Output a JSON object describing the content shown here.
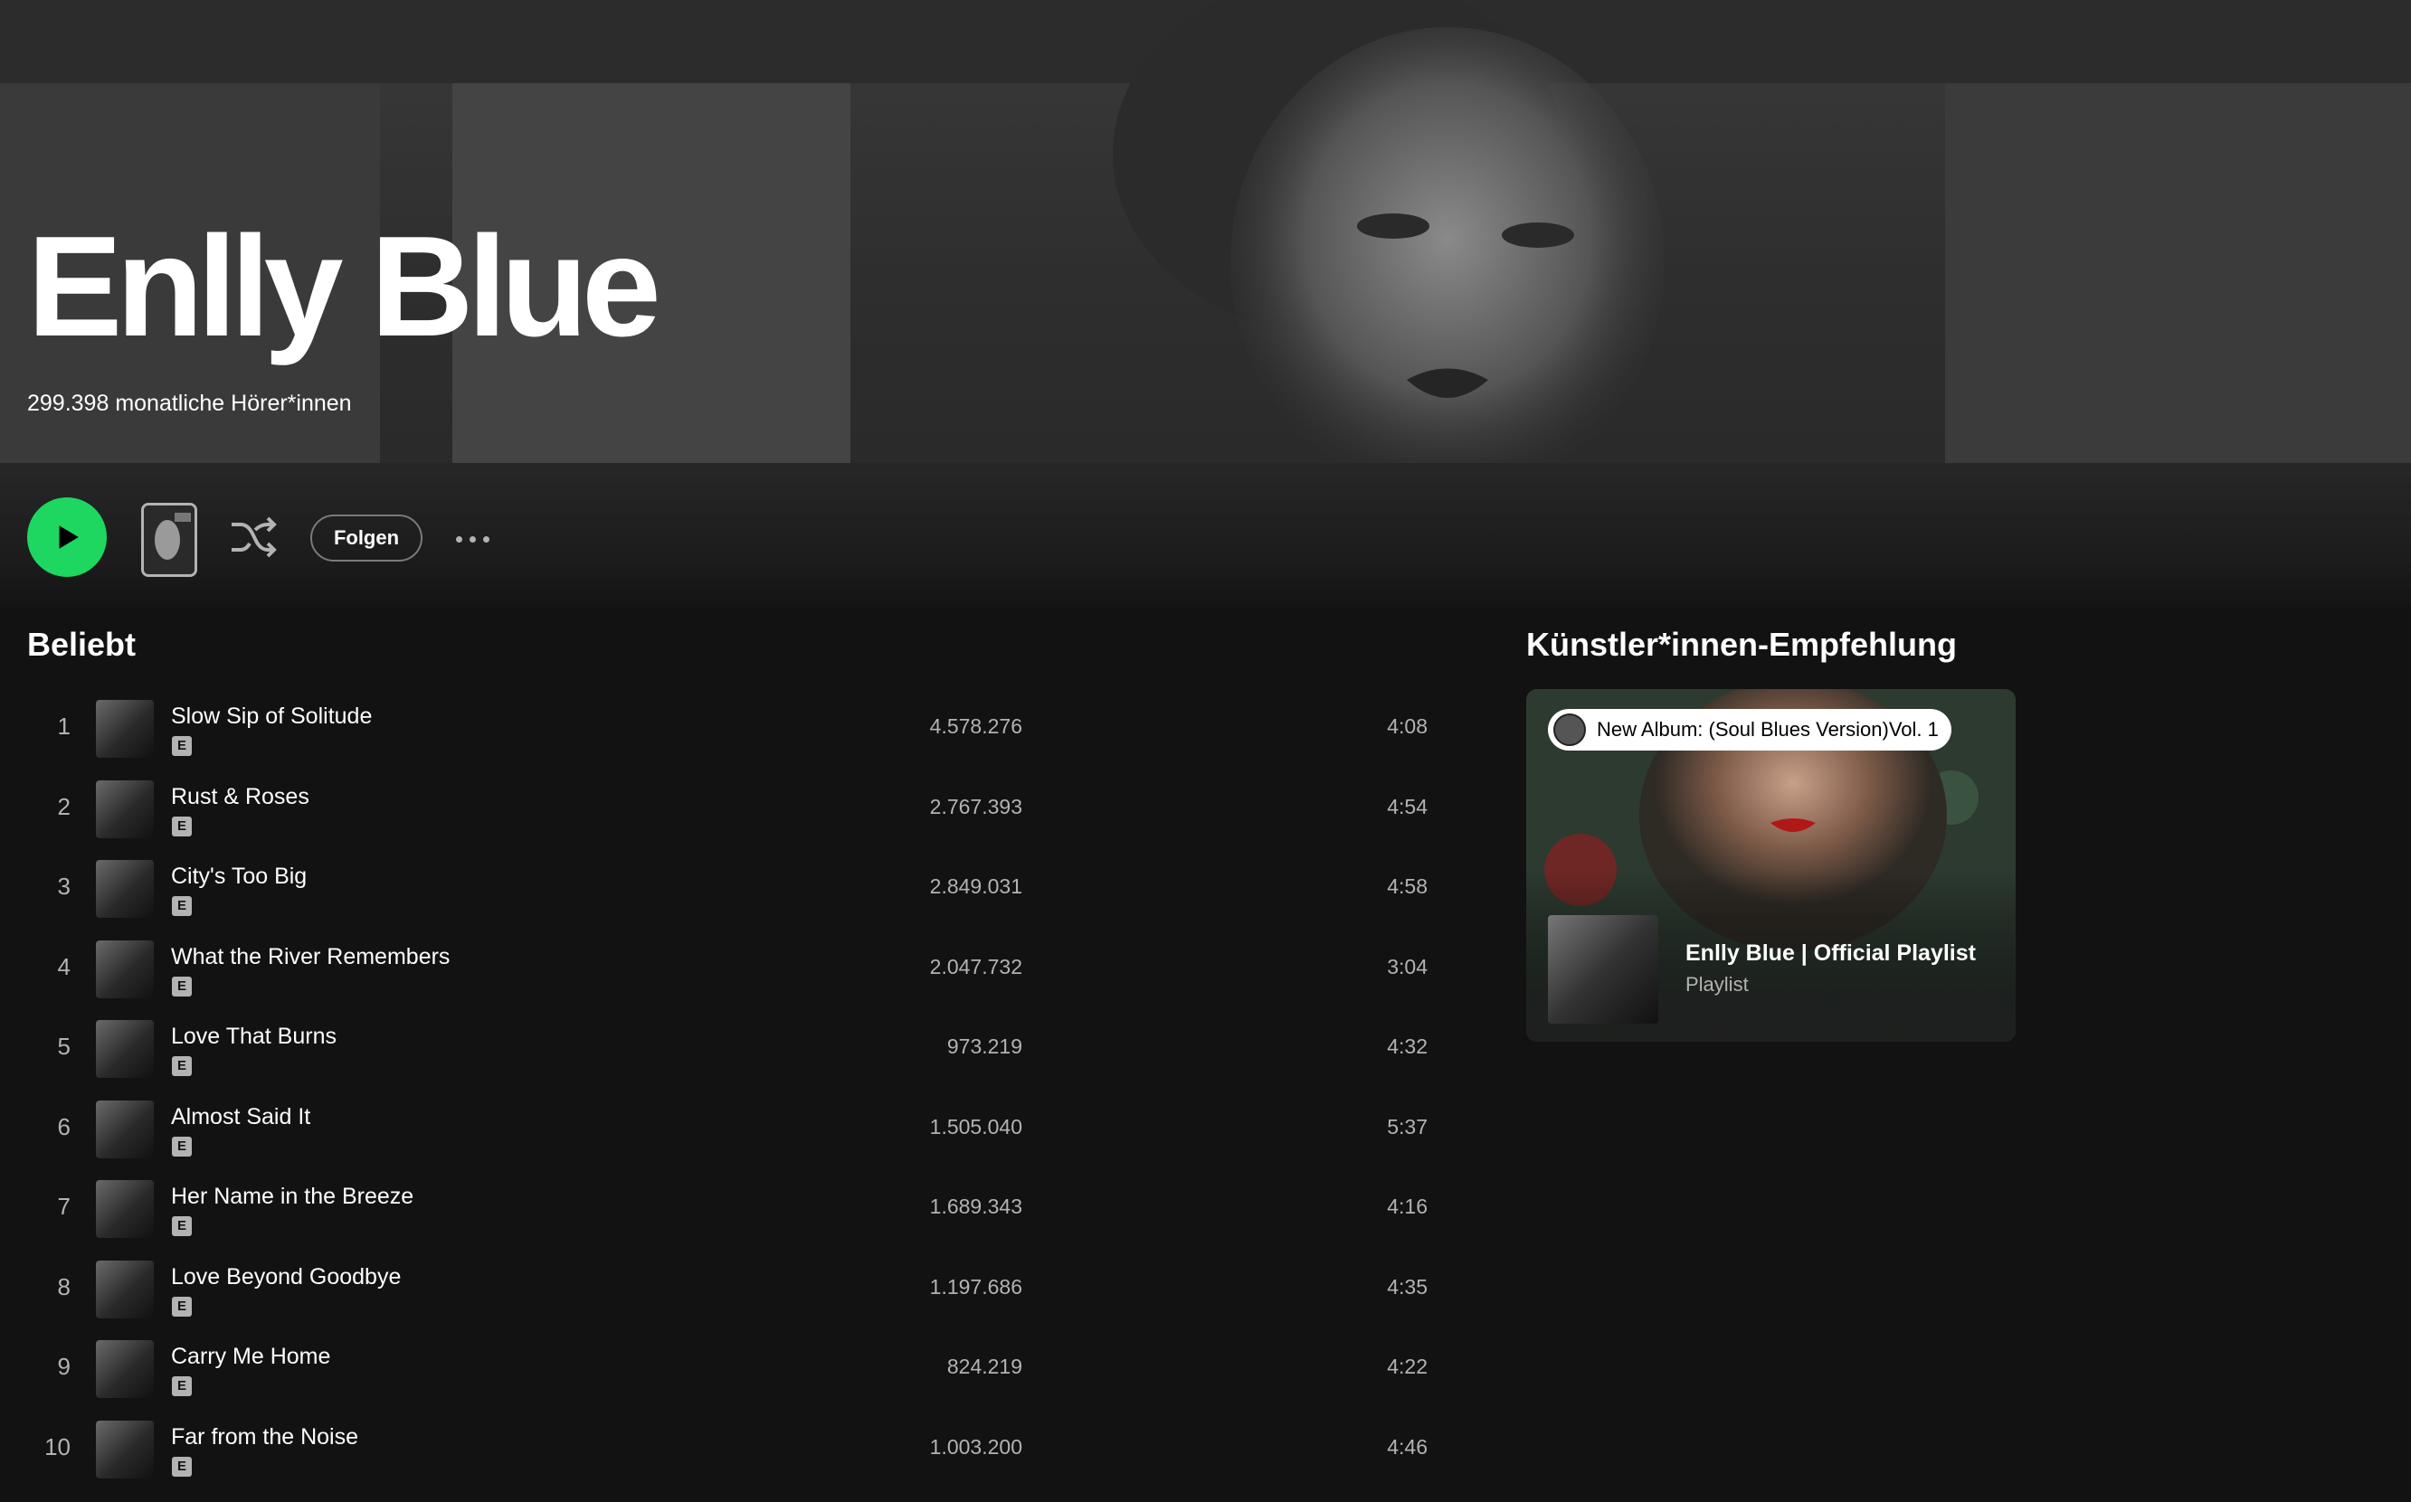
{
  "artist": {
    "name": "Enlly Blue",
    "monthly_listeners": "299.398 monatliche Hörer*innen"
  },
  "actions": {
    "follow_label": "Folgen"
  },
  "popular": {
    "title": "Beliebt",
    "tracks": [
      {
        "num": "1",
        "title": "Slow Sip of Solitude",
        "plays": "4.578.276",
        "duration": "4:08",
        "explicit": "E"
      },
      {
        "num": "2",
        "title": "Rust & Roses",
        "plays": "2.767.393",
        "duration": "4:54",
        "explicit": "E"
      },
      {
        "num": "3",
        "title": "City's Too Big",
        "plays": "2.849.031",
        "duration": "4:58",
        "explicit": "E"
      },
      {
        "num": "4",
        "title": "What the River Remembers",
        "plays": "2.047.732",
        "duration": "3:04",
        "explicit": "E"
      },
      {
        "num": "5",
        "title": "Love That Burns",
        "plays": "973.219",
        "duration": "4:32",
        "explicit": "E"
      },
      {
        "num": "6",
        "title": "Almost Said It",
        "plays": "1.505.040",
        "duration": "5:37",
        "explicit": "E"
      },
      {
        "num": "7",
        "title": "Her Name in the Breeze",
        "plays": "1.689.343",
        "duration": "4:16",
        "explicit": "E"
      },
      {
        "num": "8",
        "title": "Love Beyond Goodbye",
        "plays": "1.197.686",
        "duration": "4:35",
        "explicit": "E"
      },
      {
        "num": "9",
        "title": "Carry Me Home",
        "plays": "824.219",
        "duration": "4:22",
        "explicit": "E"
      },
      {
        "num": "10",
        "title": "Far from the Noise",
        "plays": "1.003.200",
        "duration": "4:46",
        "explicit": "E"
      }
    ]
  },
  "recommendation": {
    "title": "Künstler*innen-Empfehlung",
    "pill_text": "New Album: (Soul Blues Version)Vol. 1",
    "playlist_name": "Enlly Blue | Official Playlist",
    "playlist_type": "Playlist"
  },
  "colors": {
    "play_green": "#1ed760",
    "background": "#121212",
    "secondary_text": "#b3b3b3"
  },
  "icons": [
    "play-icon",
    "shuffle-icon",
    "more-options-icon",
    "explicit-badge"
  ]
}
